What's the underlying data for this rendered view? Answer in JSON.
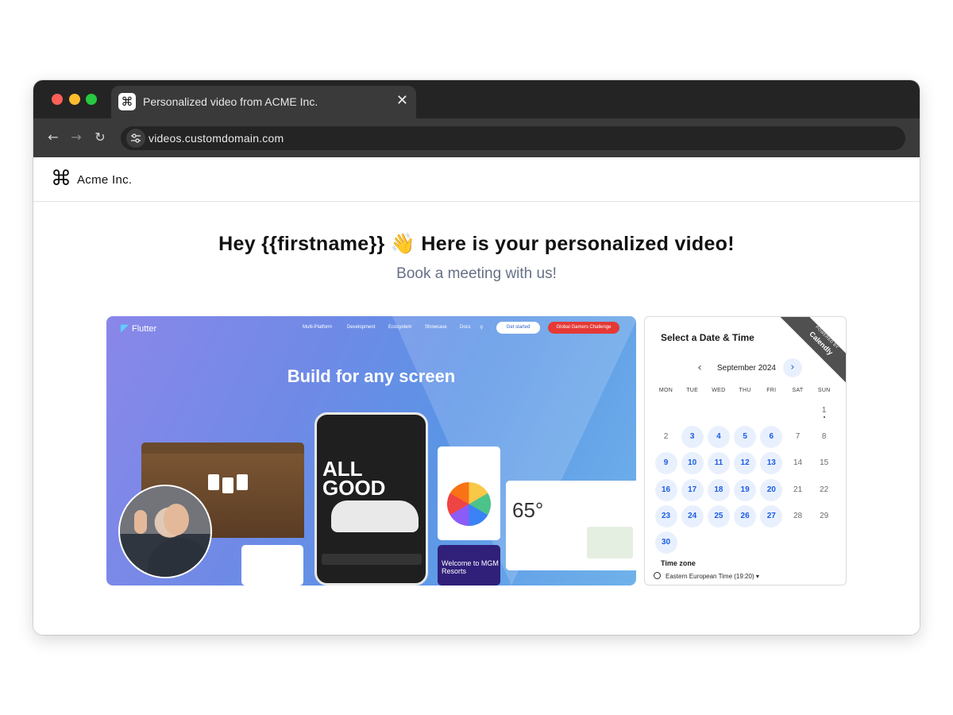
{
  "browser": {
    "tab_title": "Personalized video from ACME Inc.",
    "tab_close": "✕",
    "favicon_glyph": "⌘",
    "url": "videos.customdomain.com",
    "back": "←",
    "forward": "→",
    "reload": "↻"
  },
  "site": {
    "brand_glyph": "⌘",
    "brand_name": "Acme Inc.",
    "headline": "Hey {{firstname}} 👋 Here is your personalized video!",
    "subhead": "Book a meeting with us!"
  },
  "video": {
    "logo": "Flutter",
    "nav": [
      "Multi-Platform",
      "Development",
      "Ecosystem",
      "Showcase",
      "Docs"
    ],
    "get_started": "Get started",
    "challenge": "Global Gamers Challenge",
    "hero": "Build for any screen",
    "phone_text": "ALL GOOD",
    "weather_temp": "65°",
    "mgm": "Welcome to MGM Resorts"
  },
  "calendar": {
    "title": "Select a Date & Time",
    "ribbon_small": "POWERED BY",
    "ribbon_big": "Calendly",
    "prev": "‹",
    "next": "›",
    "month": "September 2024",
    "weekdays": [
      "MON",
      "TUE",
      "WED",
      "THU",
      "FRI",
      "SAT",
      "SUN"
    ],
    "days": [
      {
        "d": "1",
        "avail": false,
        "col": 6,
        "row": 0,
        "today": true
      },
      {
        "d": "2",
        "avail": false,
        "col": 0,
        "row": 1
      },
      {
        "d": "3",
        "avail": true,
        "col": 1,
        "row": 1
      },
      {
        "d": "4",
        "avail": true,
        "col": 2,
        "row": 1
      },
      {
        "d": "5",
        "avail": true,
        "col": 3,
        "row": 1
      },
      {
        "d": "6",
        "avail": true,
        "col": 4,
        "row": 1
      },
      {
        "d": "7",
        "avail": false,
        "col": 5,
        "row": 1
      },
      {
        "d": "8",
        "avail": false,
        "col": 6,
        "row": 1
      },
      {
        "d": "9",
        "avail": true,
        "col": 0,
        "row": 2
      },
      {
        "d": "10",
        "avail": true,
        "col": 1,
        "row": 2
      },
      {
        "d": "11",
        "avail": true,
        "col": 2,
        "row": 2
      },
      {
        "d": "12",
        "avail": true,
        "col": 3,
        "row": 2
      },
      {
        "d": "13",
        "avail": true,
        "col": 4,
        "row": 2
      },
      {
        "d": "14",
        "avail": false,
        "col": 5,
        "row": 2
      },
      {
        "d": "15",
        "avail": false,
        "col": 6,
        "row": 2
      },
      {
        "d": "16",
        "avail": true,
        "col": 0,
        "row": 3
      },
      {
        "d": "17",
        "avail": true,
        "col": 1,
        "row": 3
      },
      {
        "d": "18",
        "avail": true,
        "col": 2,
        "row": 3
      },
      {
        "d": "19",
        "avail": true,
        "col": 3,
        "row": 3
      },
      {
        "d": "20",
        "avail": true,
        "col": 4,
        "row": 3
      },
      {
        "d": "21",
        "avail": false,
        "col": 5,
        "row": 3
      },
      {
        "d": "22",
        "avail": false,
        "col": 6,
        "row": 3
      },
      {
        "d": "23",
        "avail": true,
        "col": 0,
        "row": 4
      },
      {
        "d": "24",
        "avail": true,
        "col": 1,
        "row": 4
      },
      {
        "d": "25",
        "avail": true,
        "col": 2,
        "row": 4
      },
      {
        "d": "26",
        "avail": true,
        "col": 3,
        "row": 4
      },
      {
        "d": "27",
        "avail": true,
        "col": 4,
        "row": 4
      },
      {
        "d": "28",
        "avail": false,
        "col": 5,
        "row": 4
      },
      {
        "d": "29",
        "avail": false,
        "col": 6,
        "row": 4
      },
      {
        "d": "30",
        "avail": true,
        "col": 0,
        "row": 5
      }
    ],
    "timezone_label": "Time zone",
    "timezone_value": "Eastern European Time (19:20) ▾"
  },
  "colors": {
    "accent": "#1a5ce6",
    "available_bg": "#e9f0fd"
  }
}
